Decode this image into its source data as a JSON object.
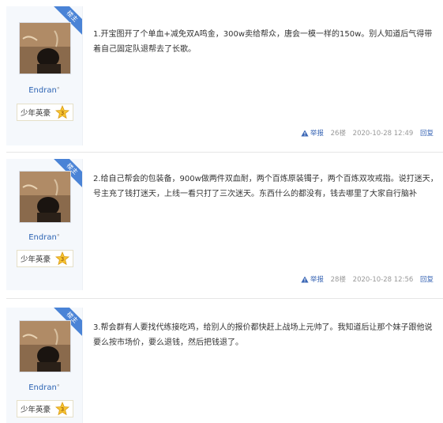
{
  "posts": [
    {
      "badge": "楼主",
      "author": "Endran",
      "gender_mark": "°",
      "rank": "少年英豪",
      "content": "1.开宝图开了个单血+减免双A鸣金，300w卖给帮众，唐会一模一样的150w。别人知道后气得带着自己固定队退帮去了长歌。",
      "report": "举报",
      "floor": "26楼",
      "time": "2020-10-28 12:49",
      "reply": "回复"
    },
    {
      "badge": "楼主",
      "author": "Endran",
      "gender_mark": "°",
      "rank": "少年英豪",
      "content": "2.给自己帮会的包装备，900w做两件双血耐，两个百炼原装镯子，两个百炼双攻戒指。说打迷天，号主充了钱打迷天，上线一看只打了三次迷天。东西什么的都没有，钱去哪里了大家自行脑补",
      "report": "举报",
      "floor": "28楼",
      "time": "2020-10-28 12:56",
      "reply": "回复"
    },
    {
      "badge": "楼主",
      "author": "Endran",
      "gender_mark": "°",
      "rank": "少年英豪",
      "content": "3.帮会群有人要找代练接吃鸡，给别人的报价都快赶上战场上元帅了。我知道后让那个妹子跟他说要么按市场价，要么退钱，然后把钱退了。",
      "report": "",
      "floor": "",
      "time": "",
      "reply": ""
    }
  ],
  "colors": {
    "badge": "#4a83d6",
    "author": "#2d64b3",
    "link": "#3a66b5",
    "meta": "#999999",
    "sidebar": "#f5f8fc"
  },
  "icons": {
    "rank": "star-level-3-icon",
    "report": "warning-icon"
  }
}
